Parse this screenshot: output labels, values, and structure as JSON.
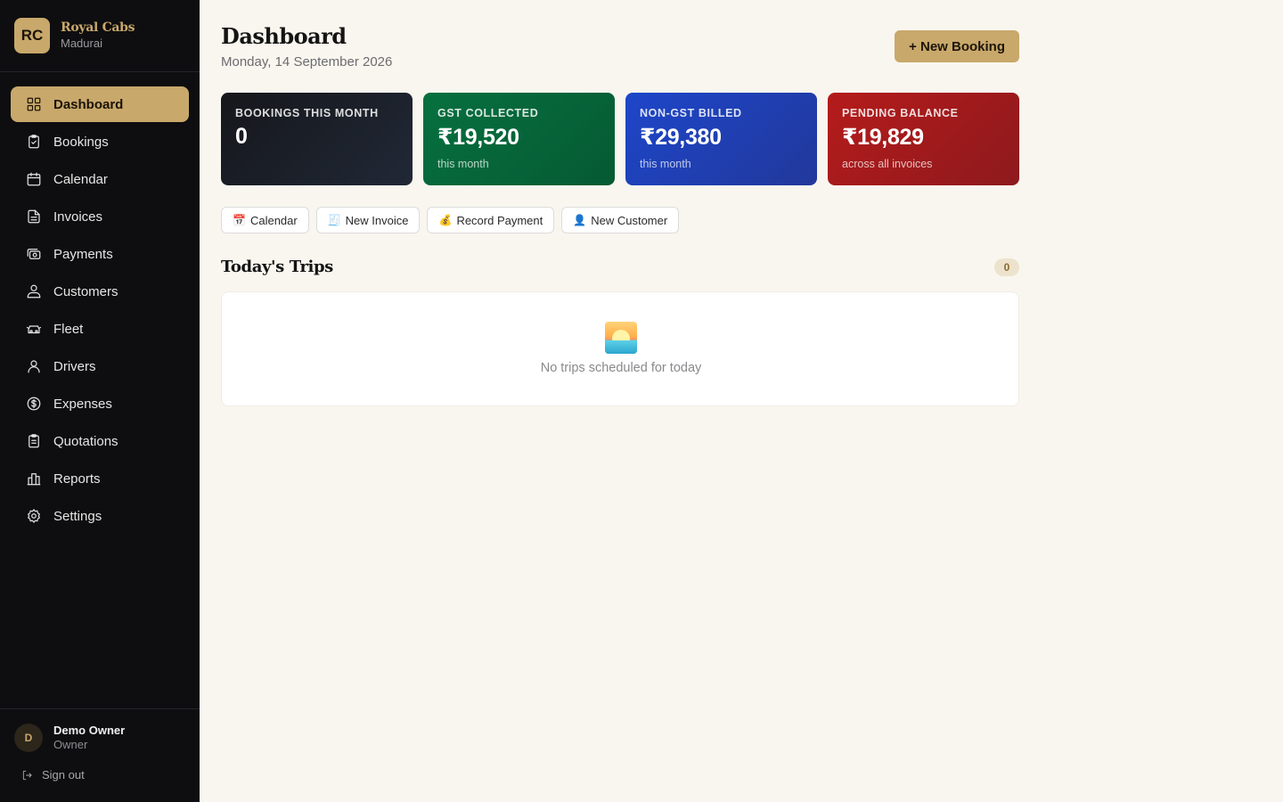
{
  "brand": {
    "initials": "RC",
    "name": "Royal Cabs",
    "city": "Madurai"
  },
  "sidebar": {
    "items": [
      {
        "label": "Dashboard",
        "icon": "grid-icon",
        "active": true
      },
      {
        "label": "Bookings",
        "icon": "clipboard-check-icon"
      },
      {
        "label": "Calendar",
        "icon": "calendar-icon"
      },
      {
        "label": "Invoices",
        "icon": "file-text-icon"
      },
      {
        "label": "Payments",
        "icon": "banknote-icon"
      },
      {
        "label": "Customers",
        "icon": "users-icon"
      },
      {
        "label": "Fleet",
        "icon": "car-icon"
      },
      {
        "label": "Drivers",
        "icon": "user-icon"
      },
      {
        "label": "Expenses",
        "icon": "dollar-circle-icon"
      },
      {
        "label": "Quotations",
        "icon": "clipboard-list-icon"
      },
      {
        "label": "Reports",
        "icon": "bar-chart-icon"
      },
      {
        "label": "Settings",
        "icon": "gear-icon"
      }
    ]
  },
  "user": {
    "initial": "D",
    "name": "Demo Owner",
    "role": "Owner",
    "signout_label": "Sign out"
  },
  "header": {
    "title": "Dashboard",
    "date": "Monday, 14 September 2026",
    "new_booking_label": "+ New Booking"
  },
  "stats": [
    {
      "label": "Bookings This Month",
      "value": "0",
      "sub": "",
      "color": "#15171b"
    },
    {
      "label": "GST Collected",
      "value": "₹19,520",
      "sub": "this month",
      "color": "#07703f"
    },
    {
      "label": "Non-GST Billed",
      "value": "₹29,380",
      "sub": "this month",
      "color": "#1d46c9"
    },
    {
      "label": "Pending Balance",
      "value": "₹19,829",
      "sub": "across all invoices",
      "color": "#b51b1b"
    }
  ],
  "quick_actions": [
    {
      "emoji": "📅",
      "label": "Calendar"
    },
    {
      "emoji": "🧾",
      "label": "New Invoice"
    },
    {
      "emoji": "💰",
      "label": "Record Payment"
    },
    {
      "emoji": "👤",
      "label": "New Customer"
    }
  ],
  "trips": {
    "title": "Today's Trips",
    "count": "0",
    "empty_icon": "sunrise-icon",
    "empty_message": "No trips scheduled for today"
  },
  "colors": {
    "accent": "#c9a86b",
    "sidebar_bg": "#0e0e10",
    "page_bg": "#f9f6ef"
  }
}
